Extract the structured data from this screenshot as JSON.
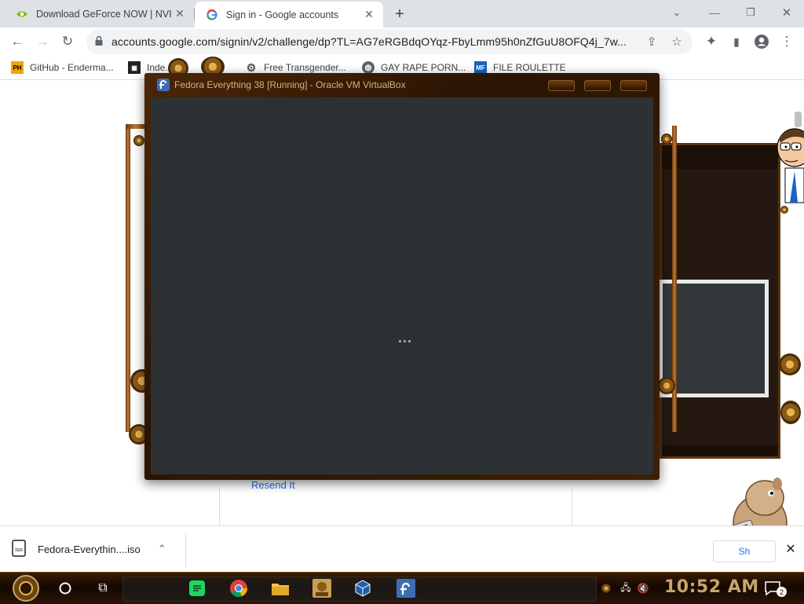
{
  "tabs": [
    {
      "title": "Download GeForce NOW | NVIDIA",
      "icon": "nvidia-icon",
      "active": false
    },
    {
      "title": "Sign in - Google accounts",
      "icon": "google-icon",
      "active": true
    }
  ],
  "toolbar": {
    "url": "accounts.google.com/signin/v2/challenge/dp?TL=AG7eRGBdqOYqz-FbyLmm95h0nZfGuU8OFQ4j_7w..."
  },
  "bookmarks": [
    {
      "label": "GitHub - Enderma...",
      "icon": "ph-icon",
      "icon_text": "PH",
      "color": "#f0a500"
    },
    {
      "label": "Inde...",
      "icon": "grid-icon",
      "icon_text": "",
      "color": "#222222"
    },
    {
      "label": "Free Transgender...",
      "icon": "gear-icon",
      "icon_text": "",
      "color": "#555555"
    },
    {
      "label": "GAY RAPE PORN...",
      "icon": "globe-icon",
      "icon_text": "",
      "color": "#5f6368"
    },
    {
      "label": "FILE ROULETTE",
      "icon": "mf-icon",
      "icon_text": "MF",
      "color": "#1565c0"
    }
  ],
  "page": {
    "resend_link": "Resend It"
  },
  "vbox": {
    "title": "Fedora Everything 38 [Running] - Oracle VM VirtualBox"
  },
  "downloads": {
    "filename": "Fedora-Everythin....iso"
  },
  "backwin": {
    "label": "Sh"
  },
  "taskbar": {
    "time": "10:52 AM",
    "notification_count": "2"
  },
  "colors": {
    "chrome_bg": "#dee1e6",
    "link": "#1a73e8",
    "vbox_frame": "#3d2006",
    "vbox_screen": "#2e3133",
    "clock": "#c9a46b"
  }
}
